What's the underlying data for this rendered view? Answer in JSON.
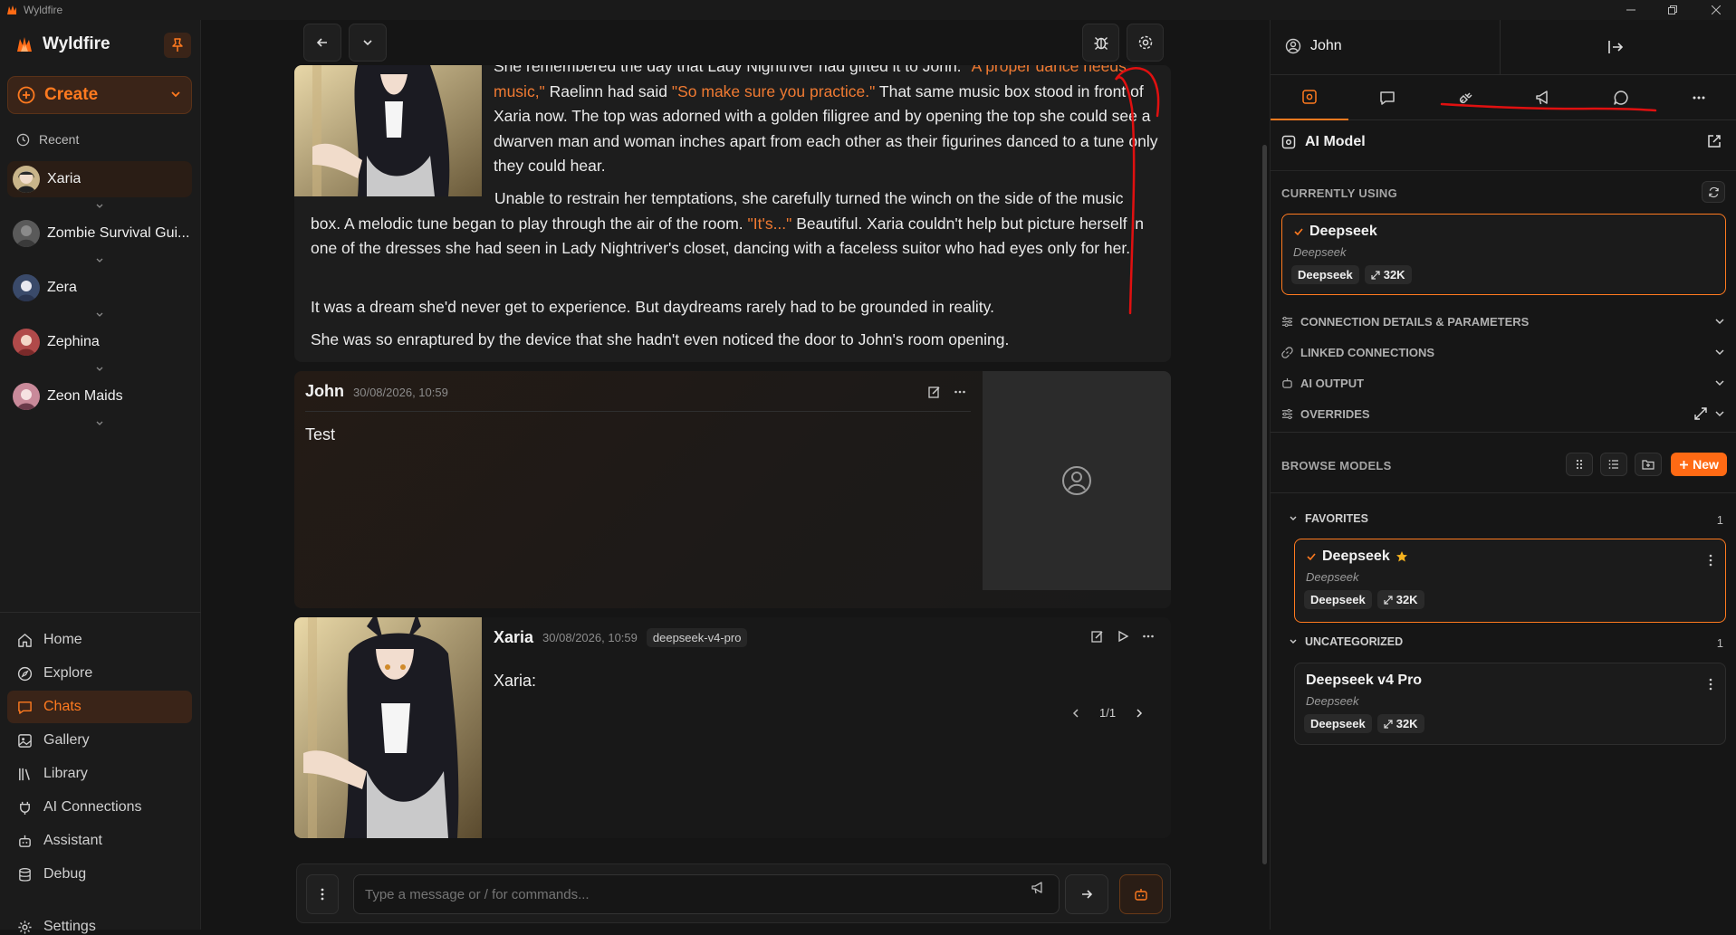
{
  "window": {
    "title": "Wyldfire"
  },
  "sidebar": {
    "brand": "Wyldfire",
    "create_label": "Create",
    "recent_label": "Recent",
    "chats": [
      {
        "label": "Xaria"
      },
      {
        "label": "Zombie Survival Gui..."
      },
      {
        "label": "Zera"
      },
      {
        "label": "Zephina"
      },
      {
        "label": "Zeon Maids"
      }
    ],
    "nav": [
      {
        "label": "Home",
        "icon": "home-icon"
      },
      {
        "label": "Explore",
        "icon": "compass-icon"
      },
      {
        "label": "Chats",
        "icon": "chat-icon"
      },
      {
        "label": "Gallery",
        "icon": "image-icon"
      },
      {
        "label": "Library",
        "icon": "library-icon"
      },
      {
        "label": "AI Connections",
        "icon": "plug-icon"
      },
      {
        "label": "Assistant",
        "icon": "bot-icon"
      },
      {
        "label": "Debug",
        "icon": "database-icon"
      }
    ],
    "settings_label": "Settings"
  },
  "chat": {
    "narration": {
      "p1_a": "She remembered the day that Lady Nightriver had gifted it to John. ",
      "p1_q1": "\"A proper dance needs music,\"",
      "p1_b": " Raelinn had said ",
      "p1_q2": "\"So make sure you practice.\"",
      "p1_c": " That same music box stood in front of Xaria now. The top was adorned with a golden filigree and by opening the top she could see a dwarven man and woman inches apart from each other as their figurines danced to a tune only they could hear.",
      "p2_a": "Unable to restrain her temptations, she carefully turned the winch on the side of the music box. A melodic tune began to play through the air of the room. ",
      "p2_q": "\"It's...\"",
      "p2_b": " Beautiful. Xaria couldn't help but picture herself in one of the dresses she had seen in Lady Nightriver's closet, dancing with a faceless suitor who had eyes only for her.",
      "p3": "It was a dream she'd never get to experience. But daydreams rarely had to be grounded in reality.",
      "p4": "She was so enraptured by the device that she hadn't even noticed the door to John's room opening."
    },
    "user_msg": {
      "name": "John",
      "timestamp": "30/08/2026, 10:59",
      "text": "Test"
    },
    "bot_msg": {
      "name": "Xaria",
      "timestamp": "30/08/2026, 10:59",
      "model": "deepseek-v4-pro",
      "text": "Xaria:",
      "pager": "1/1"
    },
    "composer": {
      "placeholder": "Type a message or / for commands..."
    }
  },
  "right_panel": {
    "user": "John",
    "title": "AI Model",
    "currently_using_label": "CURRENTLY USING",
    "current": {
      "name": "Deepseek",
      "provider": "Deepseek",
      "tag": "Deepseek",
      "context": "32K"
    },
    "accordions": [
      "CONNECTION DETAILS & PARAMETERS",
      "LINKED CONNECTIONS",
      "AI OUTPUT",
      "OVERRIDES"
    ],
    "browse_label": "BROWSE MODELS",
    "new_label": "New",
    "favorites": {
      "label": "FAVORITES",
      "count": "1",
      "item": {
        "name": "Deepseek",
        "provider": "Deepseek",
        "tag": "Deepseek",
        "context": "32K"
      }
    },
    "uncategorized": {
      "label": "UNCATEGORIZED",
      "count": "1",
      "item": {
        "name": "Deepseek v4 Pro",
        "provider": "Deepseek",
        "tag": "Deepseek",
        "context": "32K"
      }
    }
  },
  "colors": {
    "accent": "#ff7a1f",
    "background": "#151515",
    "quote": "#f07a32",
    "annotation": "#e01010"
  }
}
